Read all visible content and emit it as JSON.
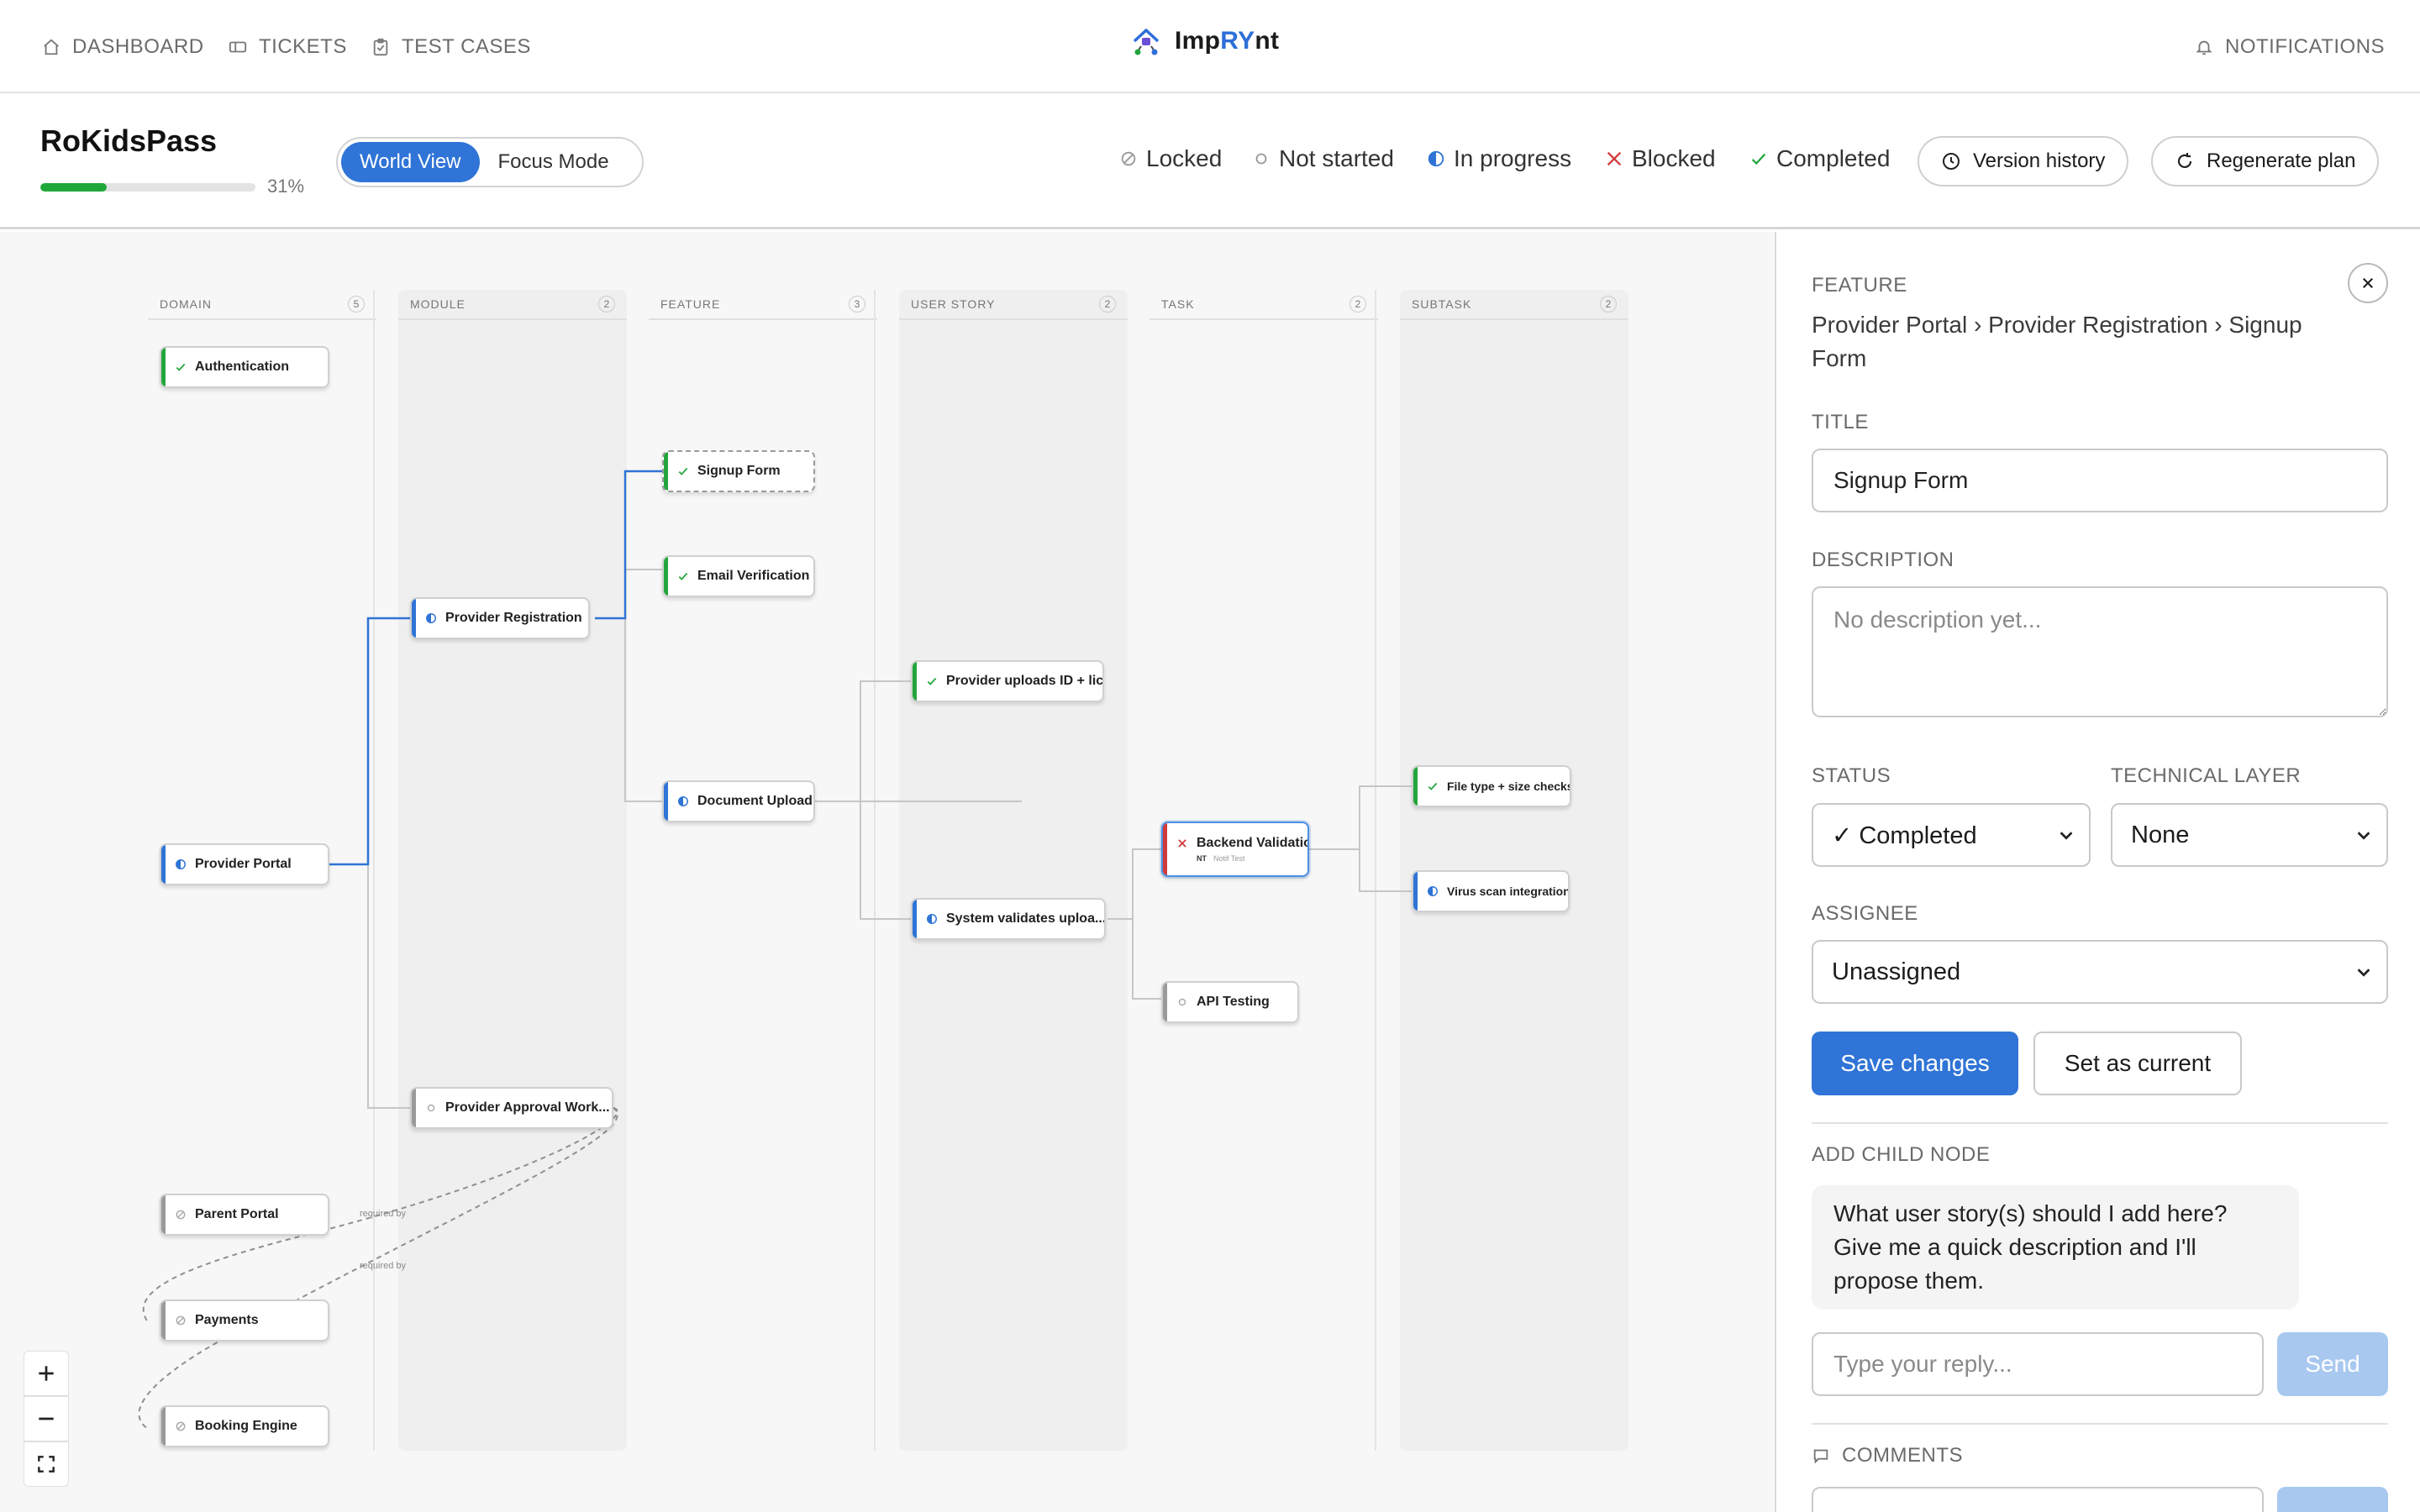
{
  "nav": {
    "dashboard": "DASHBOARD",
    "tickets": "TICKETS",
    "test_cases": "TEST CASES",
    "logo_prefix": "Imp",
    "logo_highlight": "RY",
    "logo_suffix": "nt",
    "notifications": "NOTIFICATIONS"
  },
  "project": {
    "title": "RoKidsPass",
    "progress": 0.31,
    "progress_label": "31%"
  },
  "view_modes": {
    "world": "World View",
    "focus": "Focus Mode",
    "active": "World View"
  },
  "legend": {
    "locked": "Locked",
    "not_started": "Not started",
    "in_progress": "In progress",
    "blocked": "Blocked",
    "completed": "Completed"
  },
  "header_buttons": {
    "version_history": "Version history",
    "regenerate": "Regenerate plan"
  },
  "colors": {
    "accent": "#2f74d6",
    "completed": "#22a63c",
    "blocked": "#d13a3a",
    "neutral": "#9a9a9a"
  },
  "lanes": [
    {
      "title": "DOMAIN",
      "count": "5"
    },
    {
      "title": "MODULE",
      "count": "2"
    },
    {
      "title": "FEATURE",
      "count": "3"
    },
    {
      "title": "USER STORY",
      "count": "2"
    },
    {
      "title": "TASK",
      "count": "2"
    },
    {
      "title": "SUBTASK",
      "count": "2"
    }
  ],
  "nodes": {
    "authentication": {
      "label": "Authentication",
      "status": "completed"
    },
    "provider_portal": {
      "label": "Provider Portal",
      "status": "in_progress"
    },
    "parent_portal": {
      "label": "Parent Portal",
      "status": "locked"
    },
    "payments": {
      "label": "Payments",
      "status": "locked"
    },
    "booking_engine": {
      "label": "Booking Engine",
      "status": "locked"
    },
    "provider_registration": {
      "label": "Provider Registration",
      "status": "in_progress"
    },
    "provider_approval": {
      "label": "Provider Approval Work...",
      "status": "not_started"
    },
    "signup_form": {
      "label": "Signup Form",
      "status": "completed"
    },
    "email_verification": {
      "label": "Email Verification",
      "status": "completed"
    },
    "document_upload": {
      "label": "Document Upload",
      "status": "in_progress"
    },
    "story_uploads": {
      "label": "Provider uploads ID + lic...",
      "status": "completed"
    },
    "story_validates": {
      "label": "System validates uploa...",
      "status": "in_progress"
    },
    "backend_validation": {
      "label": "Backend Validation",
      "status": "blocked",
      "initials": "NT",
      "assignee": "Notif Test"
    },
    "api_testing": {
      "label": "API Testing",
      "status": "not_started"
    },
    "file_checks": {
      "label": "File type + size checks",
      "status": "completed"
    },
    "virus_scan": {
      "label": "Virus scan integration",
      "status": "in_progress"
    }
  },
  "dependency_labels": {
    "first": "required by",
    "second": "required by"
  },
  "panel": {
    "type_label": "FEATURE",
    "breadcrumb": "Provider Portal › Provider Registration › Signup Form",
    "title_label": "TITLE",
    "title_value": "Signup Form",
    "description_label": "DESCRIPTION",
    "description_placeholder": "No description yet...",
    "status_label": "STATUS",
    "status_value": "✓ Completed",
    "layer_label": "TECHNICAL LAYER",
    "layer_value": "None",
    "assignee_label": "ASSIGNEE",
    "assignee_value": "Unassigned",
    "save_button": "Save changes",
    "set_current_button": "Set as current",
    "add_child_label": "ADD CHILD NODE",
    "assistant_message": "What user story(s) should I add here? Give me a quick description and I'll propose them.",
    "reply_placeholder": "Type your reply...",
    "send_button": "Send",
    "comments_label": "COMMENTS"
  }
}
